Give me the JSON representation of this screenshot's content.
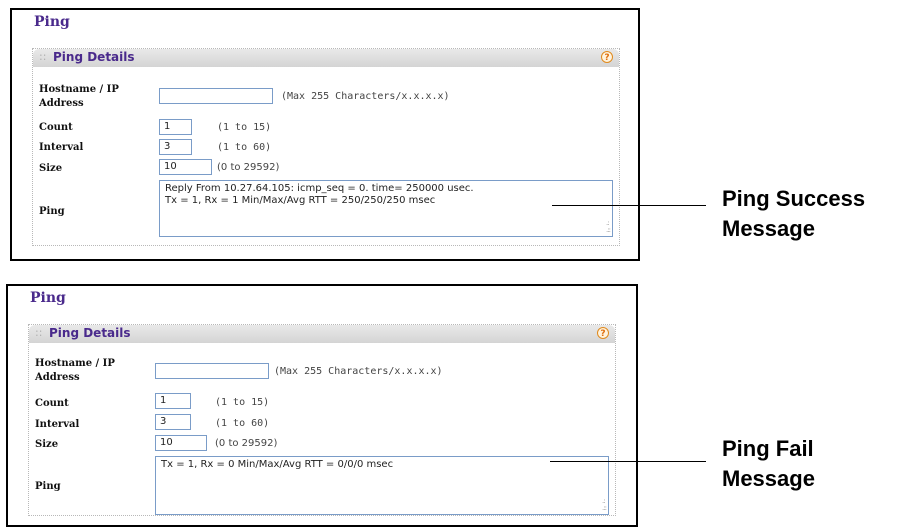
{
  "panels": [
    {
      "title": "Ping",
      "section_title": "Ping Details",
      "help_icon": "?",
      "hostname_label_line1": "Hostname / IP",
      "hostname_label_line2": "Address",
      "hostname_value": "",
      "hostname_hint": "(Max 255 Characters/x.x.x.x)",
      "count_label": "Count",
      "count_value": "1",
      "count_hint": "(1 to 15)",
      "interval_label": "Interval",
      "interval_value": "3",
      "interval_hint": "(1 to 60)",
      "size_label": "Size",
      "size_value": "10",
      "size_hint": "(0 to 29592)",
      "ping_label": "Ping",
      "ping_output_line1": "Reply From 10.27.64.105: icmp_seq = 0. time= 250000 usec.",
      "ping_output_line2": "Tx = 1, Rx = 1 Min/Max/Avg RTT = 250/250/250 msec"
    },
    {
      "title": "Ping",
      "section_title": "Ping Details",
      "help_icon": "?",
      "hostname_label_line1": "Hostname / IP",
      "hostname_label_line2": "Address",
      "hostname_value": "",
      "hostname_hint": "(Max 255 Characters/x.x.x.x)",
      "count_label": "Count",
      "count_value": "1",
      "count_hint": "(1 to 15)",
      "interval_label": "Interval",
      "interval_value": "3",
      "interval_hint": "(1 to 60)",
      "size_label": "Size",
      "size_value": "10",
      "size_hint": "(0 to 29592)",
      "ping_label": "Ping",
      "ping_output_line1": "Tx = 1, Rx = 0 Min/Max/Avg RTT = 0/0/0 msec",
      "ping_output_line2": ""
    }
  ],
  "callouts": {
    "success_line1": "Ping Success",
    "success_line2": "Message",
    "fail_line1": "Ping Fail",
    "fail_line2": "Message"
  },
  "colors": {
    "title": "#4a2a8c",
    "input_border": "#7a9cc8",
    "help_icon": "#e07010"
  }
}
